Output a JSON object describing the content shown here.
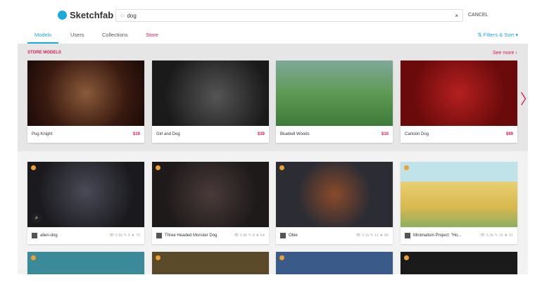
{
  "header": {
    "logo": "Sketchfab",
    "search_value": "dog",
    "clear": "×",
    "cancel": "CANCEL"
  },
  "tabs": [
    {
      "label": "Models"
    },
    {
      "label": "Users"
    },
    {
      "label": "Collections"
    },
    {
      "label": "Store"
    }
  ],
  "filters": "⇅ Filters & Sort ▾",
  "store": {
    "title": "STORE MODELS",
    "see_more": "See more ›",
    "next": "〉",
    "items": [
      {
        "name": "Pug Knight",
        "price": "$19"
      },
      {
        "name": "Girl and Dog",
        "price": "$39"
      },
      {
        "name": "Bluebell Woods",
        "price": "$10"
      },
      {
        "name": "Cartoon Dog",
        "price": "$99"
      }
    ]
  },
  "models": [
    {
      "name": "alien-dog",
      "views": "2.6k",
      "comments": "5",
      "likes": "73"
    },
    {
      "name": "Three Headed Monster Dog",
      "views": "1.8k",
      "comments": "8",
      "likes": "64"
    },
    {
      "name": "Obie",
      "views": "2.1k",
      "comments": "11",
      "likes": "80"
    },
    {
      "name": "Minimalism Project: \"Ho...",
      "views": "3.3k",
      "comments": "15",
      "likes": "91"
    }
  ],
  "colors": {
    "accent": "#1caad9",
    "store": "#d8195a"
  }
}
